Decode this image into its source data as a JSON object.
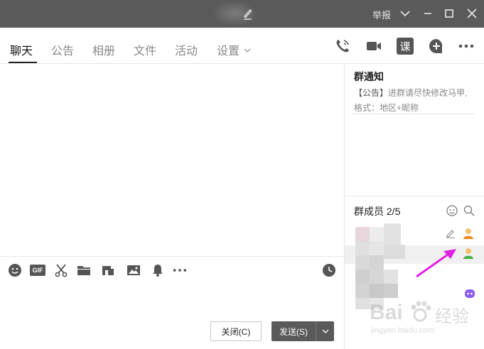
{
  "titlebar": {
    "report_label": "举报",
    "icons": [
      "edit-icon",
      "chevron-down-icon",
      "minimize-icon",
      "maximize-icon",
      "close-icon"
    ]
  },
  "tabs": [
    {
      "label": "聊天",
      "active": true
    },
    {
      "label": "公告",
      "active": false
    },
    {
      "label": "相册",
      "active": false
    },
    {
      "label": "文件",
      "active": false
    },
    {
      "label": "活动",
      "active": false
    },
    {
      "label": "设置",
      "active": false
    }
  ],
  "toolbar": {
    "icons": [
      "phone-icon",
      "video-icon",
      "class-icon",
      "add-app-icon",
      "more-icon"
    ],
    "class_label": "课"
  },
  "input_toolbar": {
    "icons": [
      "emoji-icon",
      "gif-icon",
      "scissors-icon",
      "folder-icon",
      "screenshot-icon",
      "image-icon",
      "bell-icon",
      "more-icon",
      "history-clock-icon"
    ],
    "gif_label": "GIF"
  },
  "buttons": {
    "close_label": "关闭(C)",
    "send_label": "发送(S)"
  },
  "notice": {
    "title": "群通知",
    "tag": "【公告】",
    "line1": "进群请尽快修改马甲,",
    "line2": "格式：地区+昵称"
  },
  "members": {
    "title": "群成员 2/5",
    "icons": [
      "face-icon",
      "search-icon",
      "edit-icon",
      "avatar-icon"
    ]
  },
  "watermark": {
    "brand": "Bai",
    "cn": "经验",
    "url": "jingyan.baidu.com"
  },
  "colors": {
    "titlebar": "#5a5a5a",
    "send_button": "#5a5a5a",
    "annotation_arrow": "#e020e0"
  }
}
